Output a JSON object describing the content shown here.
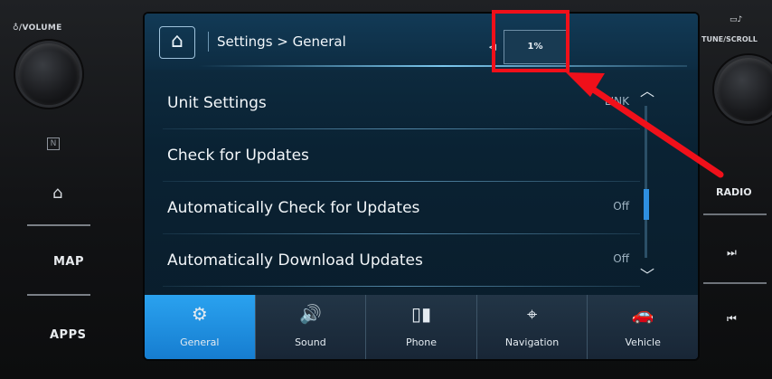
{
  "left_panel": {
    "volume_label": "♁/VOLUME",
    "n_icon": "N",
    "home_icon": "home-icon",
    "map_label": "MAP",
    "apps_label": "APPS"
  },
  "right_panel": {
    "tune_label": "TUNE/SCROLL",
    "radio_label": "RADIO",
    "next_icon": "next-track-icon",
    "prev_icon": "previous-track-icon"
  },
  "screen": {
    "breadcrumb": "Settings > General",
    "percent": "1%",
    "list_items": [
      {
        "label": "Unit Settings",
        "value": "LINK"
      },
      {
        "label": "Check for Updates",
        "value": ""
      },
      {
        "label": "Automatically Check for Updates",
        "value": "Off"
      },
      {
        "label": "Automatically Download Updates",
        "value": "Off"
      }
    ],
    "tabs": [
      {
        "label": "General",
        "icon": "gear-icon"
      },
      {
        "label": "Sound",
        "icon": "speaker-icon"
      },
      {
        "label": "Phone",
        "icon": "phone-icon"
      },
      {
        "label": "Navigation",
        "icon": "navigation-icon"
      },
      {
        "label": "Vehicle",
        "icon": "vehicle-icon"
      }
    ],
    "accent_color": "#2a9ff0"
  },
  "annotation": {
    "highlight_color": "#f0101a"
  }
}
